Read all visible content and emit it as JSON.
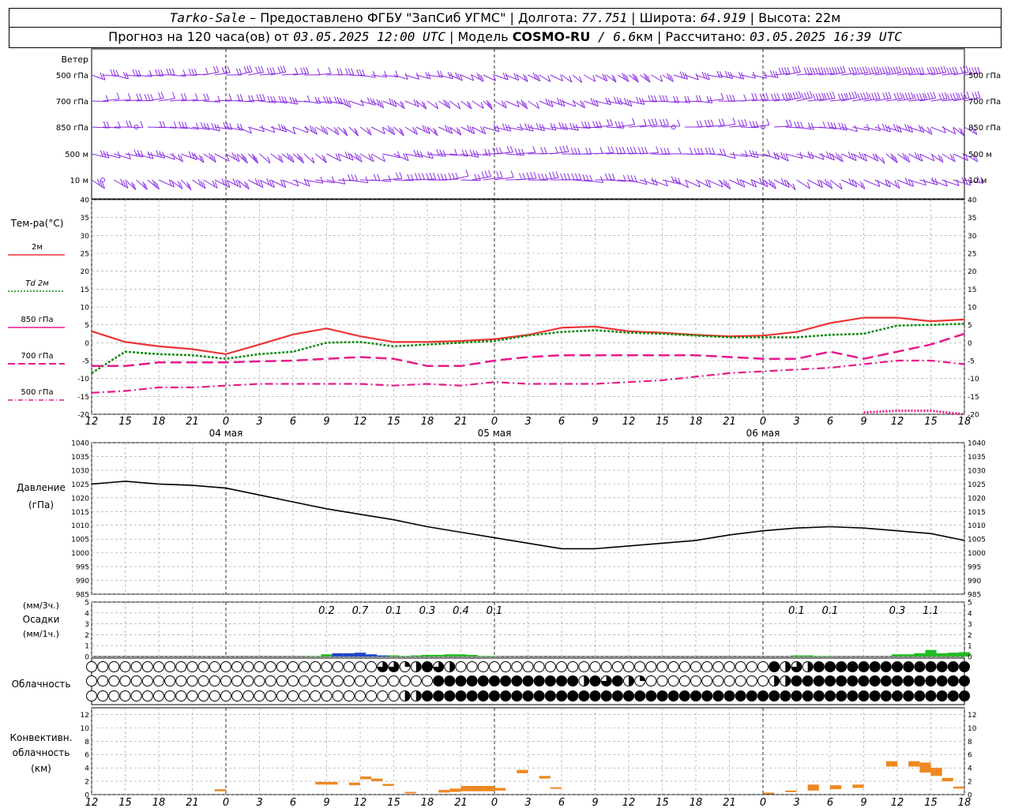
{
  "header": {
    "station": "Tarko-Sale",
    "dash": " – ",
    "provider": "Предоставлено ФГБУ \"ЗапСиб УГМС\"",
    "sep": " | ",
    "lon_label": "Долгота: ",
    "lon": "77.751",
    "lat_label": "Широта: ",
    "lat": "64.919",
    "alt_label": "Высота: ",
    "alt": "22м",
    "forecast_label": "Прогноз на 120 часа(ов) от ",
    "forecast_start": "03.05.2025 12:00 UTC",
    "model_label": "Модель ",
    "model": "COSMO-RU",
    "model_res_prefix": " / 6.6",
    "model_res_unit": "км",
    "calc_label": "Рассчитано: ",
    "calc_time": "03.05.2025 16:39 UTC"
  },
  "wind_panel": {
    "title": "Ветер",
    "levels": [
      "500 гПа",
      "700 гПа",
      "850 гПа",
      "500 м",
      "10  м"
    ]
  },
  "colors": {
    "wind": "#8a2be2",
    "t2m": "#ee3333",
    "td2m": "#118811",
    "iso": "#e8198a",
    "pressure": "#000000",
    "precip_low": "#22bb22",
    "precip_high": "#2244cc",
    "convective": "#ee8822",
    "grid": "#999999"
  },
  "time_axis": {
    "tick_labels": [
      "12",
      "15",
      "18",
      "21",
      "0",
      "3",
      "6",
      "9",
      "12",
      "15",
      "18",
      "21",
      "0",
      "3",
      "6",
      "9",
      "12",
      "15",
      "18",
      "21",
      "0",
      "3",
      "6",
      "9",
      "12",
      "15",
      "18"
    ],
    "day_labels": [
      {
        "text": "04 мая",
        "index": 4
      },
      {
        "text": "05 мая",
        "index": 12
      },
      {
        "text": "06 мая",
        "index": 20
      }
    ]
  },
  "temperature_panel": {
    "title": "Тем-ра(°C)",
    "legend": [
      {
        "text": "2м",
        "style": "solid",
        "series": "t2m"
      },
      {
        "text": "Td  2м",
        "style": "dotted",
        "series": "td2m"
      },
      {
        "text": "850 гПа",
        "style": "solid",
        "series": "t850"
      },
      {
        "text": "700 гПа",
        "style": "dash",
        "series": "t700"
      },
      {
        "text": "500 гПа",
        "style": "dashdot",
        "series": "t500"
      }
    ],
    "y_ticks": [
      40,
      35,
      30,
      25,
      20,
      15,
      10,
      5,
      0,
      -5,
      -10,
      -15,
      -20
    ]
  },
  "pressure_panel": {
    "title": "Давление",
    "unit": "(гПа)",
    "y_ticks": [
      1040,
      1035,
      1030,
      1025,
      1020,
      1015,
      1010,
      1005,
      1000,
      995,
      990,
      985
    ]
  },
  "precip_panel": {
    "unit_top": "(мм/3ч.)",
    "title": "Осадки",
    "unit_bottom": "(мм/1ч.)",
    "y_ticks": [
      5,
      4,
      3,
      2,
      1,
      0
    ],
    "labels_3h": [
      {
        "value": "0.2",
        "hour": 21
      },
      {
        "value": "0.7",
        "hour": 24
      },
      {
        "value": "0.1",
        "hour": 27
      },
      {
        "value": "0.3",
        "hour": 30
      },
      {
        "value": "0.4",
        "hour": 33
      },
      {
        "value": "0.1",
        "hour": 36
      },
      {
        "value": "0.1",
        "hour": 63
      },
      {
        "value": "0.1",
        "hour": 66
      },
      {
        "value": "0.3",
        "hour": 72
      },
      {
        "value": "1.1",
        "hour": 75
      }
    ]
  },
  "cloud_panel": {
    "title": "Облачность"
  },
  "convective_panel": {
    "title_1": "Конвективн.",
    "title_2": "облачность",
    "unit": "(км)",
    "y_ticks": [
      12,
      10,
      8,
      6,
      4,
      2,
      0
    ]
  },
  "chart_data": [
    {
      "type": "line",
      "title": "Тем-ра(°C)",
      "x_hours_from_start": [
        0,
        3,
        6,
        9,
        12,
        15,
        18,
        21,
        24,
        27,
        30,
        33,
        36,
        39,
        42,
        45,
        48,
        51,
        54,
        57,
        60,
        63,
        66,
        69,
        72,
        75,
        78
      ],
      "ylim": [
        -20,
        40
      ],
      "series": [
        {
          "name": "2м",
          "values": [
            3.2,
            0.2,
            -1.0,
            -1.8,
            -3.2,
            -0.5,
            2.3,
            4.0,
            1.8,
            0.2,
            0.2,
            0.5,
            1.0,
            2.2,
            4.2,
            4.5,
            3.2,
            2.8,
            2.2,
            1.8,
            2.0,
            3.0,
            5.5,
            7.0,
            7.0,
            6.0,
            6.5
          ]
        },
        {
          "name": "Td  2м",
          "values": [
            -8.5,
            -2.5,
            -3.2,
            -3.5,
            -4.5,
            -3.2,
            -2.5,
            0.0,
            0.2,
            -1.0,
            -0.5,
            0.0,
            0.5,
            2.0,
            3.0,
            3.5,
            2.8,
            2.5,
            2.0,
            1.5,
            1.5,
            1.5,
            2.2,
            2.5,
            4.8,
            5.0,
            5.3
          ]
        },
        {
          "name": "700 гПа",
          "values": [
            -6.5,
            -6.5,
            -5.5,
            -5.5,
            -5.5,
            -5.2,
            -5.0,
            -4.5,
            -4.0,
            -4.5,
            -6.5,
            -6.5,
            -5.0,
            -4.0,
            -3.5,
            -3.5,
            -3.5,
            -3.5,
            -3.5,
            -4.0,
            -4.5,
            -4.5,
            -2.5,
            -4.5,
            -2.5,
            -0.5,
            2.5
          ]
        },
        {
          "name": "500 гПа",
          "values": [
            -14.0,
            -13.5,
            -12.5,
            -12.5,
            -12.0,
            -11.5,
            -11.5,
            -11.5,
            -11.5,
            -12.0,
            -11.5,
            -12.0,
            -11.0,
            -11.5,
            -11.5,
            -11.5,
            -11.0,
            -10.5,
            -9.5,
            -8.5,
            -8.0,
            -7.5,
            -7.0,
            -6.0,
            -5.0,
            -5.0,
            -6.0
          ]
        },
        {
          "name": "850 гПа",
          "values": [
            null,
            null,
            null,
            null,
            null,
            null,
            null,
            null,
            null,
            null,
            null,
            null,
            null,
            null,
            null,
            null,
            null,
            null,
            null,
            null,
            null,
            null,
            null,
            -19.5,
            -19.0,
            -19.0,
            -20.0
          ]
        }
      ]
    },
    {
      "type": "line",
      "title": "Давление",
      "ylabel": "(гПа)",
      "ylim": [
        985,
        1040
      ],
      "x_hours_from_start": [
        0,
        3,
        6,
        9,
        12,
        15,
        18,
        21,
        24,
        27,
        30,
        33,
        36,
        39,
        42,
        45,
        48,
        51,
        54,
        57,
        60,
        63,
        66,
        69,
        72,
        75,
        78
      ],
      "values": [
        1025.0,
        1026.0,
        1025.0,
        1024.5,
        1023.5,
        1021.0,
        1018.5,
        1016.0,
        1014.0,
        1012.0,
        1009.5,
        1007.5,
        1005.5,
        1003.5,
        1001.5,
        1001.5,
        1002.5,
        1003.5,
        1004.5,
        1006.5,
        1008.0,
        1009.0,
        1009.5,
        1009.0,
        1008.0,
        1007.0,
        1004.5
      ]
    },
    {
      "type": "bar",
      "title": "Осадки",
      "ylabel": "(мм/1ч.)",
      "ylim": [
        0,
        5
      ],
      "x_hours_from_start": [
        20,
        21,
        22,
        23,
        24,
        25,
        26,
        27,
        28,
        29,
        30,
        31,
        32,
        33,
        34,
        35,
        36,
        63,
        64,
        65,
        66,
        72,
        73,
        74,
        75,
        76,
        77,
        78
      ],
      "values": [
        0.05,
        0.2,
        0.3,
        0.3,
        0.35,
        0.2,
        0.1,
        0.1,
        0.05,
        0.1,
        0.15,
        0.15,
        0.2,
        0.2,
        0.15,
        0.05,
        0.05,
        0.1,
        0.1,
        0.05,
        0.05,
        0.2,
        0.2,
        0.3,
        0.6,
        0.3,
        0.35,
        0.4
      ]
    },
    {
      "type": "bar",
      "title": "Конвективн. облачность",
      "ylabel": "(км)",
      "ylim": [
        0,
        13
      ],
      "bars": [
        {
          "x": 11.5,
          "base": 0.5,
          "top": 0.8
        },
        {
          "x": 20.5,
          "base": 1.5,
          "top": 1.9
        },
        {
          "x": 21.5,
          "base": 1.5,
          "top": 1.9
        },
        {
          "x": 23.5,
          "base": 1.4,
          "top": 1.8
        },
        {
          "x": 24.5,
          "base": 2.3,
          "top": 2.7
        },
        {
          "x": 25.5,
          "base": 2.0,
          "top": 2.4
        },
        {
          "x": 26.5,
          "base": 1.3,
          "top": 1.6
        },
        {
          "x": 28.5,
          "base": 0.2,
          "top": 0.4
        },
        {
          "x": 31.5,
          "base": 0.3,
          "top": 0.7
        },
        {
          "x": 32.5,
          "base": 0.4,
          "top": 0.9
        },
        {
          "x": 33.5,
          "base": 0.5,
          "top": 1.3
        },
        {
          "x": 34.5,
          "base": 0.5,
          "top": 1.3
        },
        {
          "x": 35.5,
          "base": 0.5,
          "top": 1.3
        },
        {
          "x": 36.5,
          "base": 0.6,
          "top": 1.0
        },
        {
          "x": 38.5,
          "base": 3.2,
          "top": 3.7
        },
        {
          "x": 40.5,
          "base": 2.4,
          "top": 2.8
        },
        {
          "x": 41.5,
          "base": 0.9,
          "top": 1.1
        },
        {
          "x": 60.5,
          "base": 0.2,
          "top": 0.3
        },
        {
          "x": 62.5,
          "base": 0.4,
          "top": 0.6
        },
        {
          "x": 64.5,
          "base": 0.6,
          "top": 1.5
        },
        {
          "x": 66.5,
          "base": 0.8,
          "top": 1.4
        },
        {
          "x": 68.5,
          "base": 1.0,
          "top": 1.5
        },
        {
          "x": 71.5,
          "base": 4.2,
          "top": 5.0
        },
        {
          "x": 73.5,
          "base": 4.2,
          "top": 5.0
        },
        {
          "x": 74.5,
          "base": 3.3,
          "top": 4.8
        },
        {
          "x": 75.5,
          "base": 2.8,
          "top": 4.0
        },
        {
          "x": 76.5,
          "base": 2.0,
          "top": 2.5
        },
        {
          "x": 77.5,
          "base": 0.9,
          "top": 1.2
        }
      ]
    }
  ]
}
